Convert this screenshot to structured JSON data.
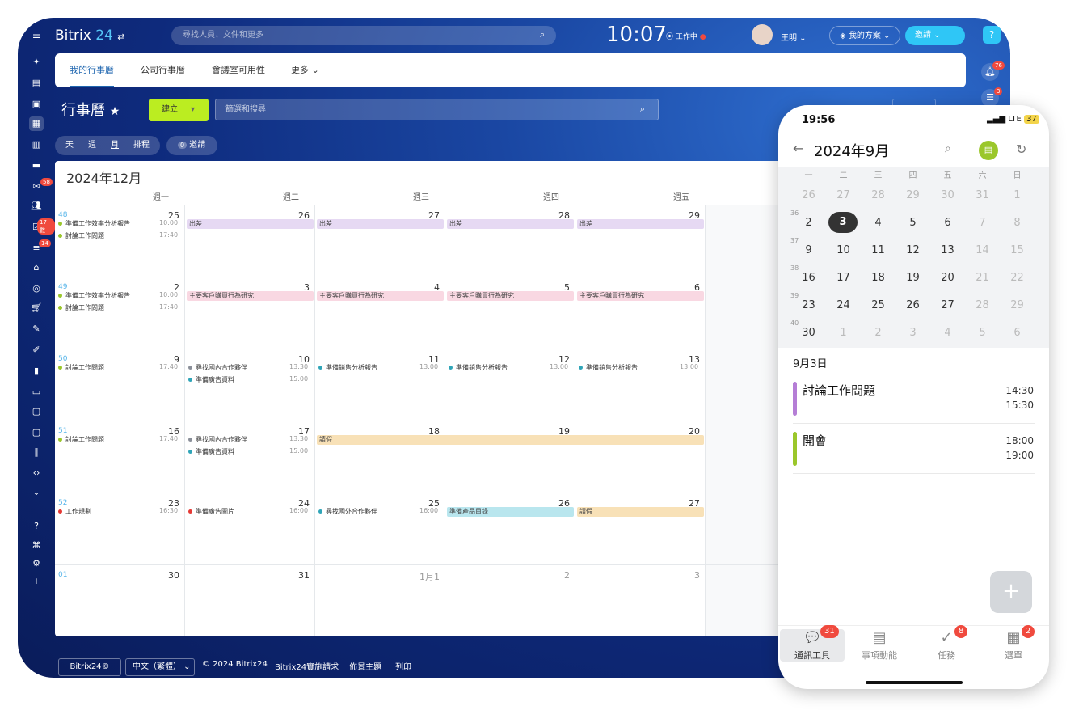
{
  "app": {
    "name": "Bitrix",
    "version": "24",
    "search_placeholder": "尋找人員、文件和更多",
    "time": "10:07",
    "work_status": "工作中",
    "user": "王明",
    "plan": "我的方案",
    "invite": "邀請"
  },
  "sidebar": {
    "badges": [
      "58",
      "17 數",
      "14"
    ],
    "top_badges": [
      "76",
      "3"
    ]
  },
  "tabs": [
    "我的行事曆",
    "公司行事曆",
    "會議室可用性",
    "更多"
  ],
  "page": {
    "title": "行事曆",
    "create": "建立",
    "filter_placeholder": "篩選和搜尋"
  },
  "views": {
    "day": "天",
    "week": "週",
    "month": "月",
    "schedule": "排程",
    "invites_count": "0",
    "invites": "邀請"
  },
  "calendar": {
    "month_label": "2024年12月",
    "weekdays": [
      "週一",
      "週二",
      "週三",
      "週四",
      "週五"
    ],
    "weeks": [
      {
        "wk": "48",
        "days": [
          "25",
          "26",
          "27",
          "28",
          "29"
        ],
        "sixth": ""
      },
      {
        "wk": "49",
        "days": [
          "2",
          "3",
          "4",
          "5",
          "6"
        ],
        "sixth": ""
      },
      {
        "wk": "50",
        "days": [
          "9",
          "10",
          "11",
          "12",
          "13"
        ],
        "sixth": ""
      },
      {
        "wk": "51",
        "days": [
          "16",
          "17",
          "18",
          "19",
          "20"
        ],
        "sixth": ""
      },
      {
        "wk": "52",
        "days": [
          "23",
          "24",
          "25",
          "26",
          "27"
        ],
        "sixth": ""
      },
      {
        "wk": "01",
        "days": [
          "30",
          "31",
          "1月1",
          "2",
          "3"
        ],
        "sixth": ""
      }
    ],
    "events": [
      {
        "week": 0,
        "day": 0,
        "row": 0,
        "title": "準備工作效率分析報告",
        "time": "10:00",
        "color": "#9bc72b"
      },
      {
        "week": 0,
        "day": 0,
        "row": 1,
        "title": "討論工作問題",
        "time": "17:40",
        "color": "#9bc72b"
      },
      {
        "week": 1,
        "day": 0,
        "row": 0,
        "title": "準備工作效率分析報告",
        "time": "10:00",
        "color": "#9bc72b"
      },
      {
        "week": 1,
        "day": 0,
        "row": 1,
        "title": "討論工作問題",
        "time": "17:40",
        "color": "#9bc72b"
      },
      {
        "week": 2,
        "day": 0,
        "row": 0,
        "title": "討論工作問題",
        "time": "17:40",
        "color": "#9bc72b"
      },
      {
        "week": 2,
        "day": 1,
        "row": 0,
        "title": "尋找國內合作夥伴",
        "time": "13:30",
        "color": "#8a8f99"
      },
      {
        "week": 2,
        "day": 1,
        "row": 1,
        "title": "準備廣告資料",
        "time": "15:00",
        "color": "#2fa5b8"
      },
      {
        "week": 2,
        "day": 2,
        "row": 0,
        "title": "準備銷售分析報告",
        "time": "13:00",
        "color": "#2fa5b8"
      },
      {
        "week": 2,
        "day": 3,
        "row": 0,
        "title": "準備銷售分析報告",
        "time": "13:00",
        "color": "#2fa5b8"
      },
      {
        "week": 2,
        "day": 4,
        "row": 0,
        "title": "準備銷售分析報告",
        "time": "13:00",
        "color": "#2fa5b8"
      },
      {
        "week": 3,
        "day": 0,
        "row": 0,
        "title": "討論工作問題",
        "time": "17:40",
        "color": "#9bc72b"
      },
      {
        "week": 3,
        "day": 1,
        "row": 0,
        "title": "尋找國內合作夥伴",
        "time": "13:30",
        "color": "#8a8f99"
      },
      {
        "week": 3,
        "day": 1,
        "row": 1,
        "title": "準備廣告資料",
        "time": "15:00",
        "color": "#2fa5b8"
      },
      {
        "week": 4,
        "day": 0,
        "row": 0,
        "title": "工作規劃",
        "time": "16:30",
        "color": "#e53935"
      },
      {
        "week": 4,
        "day": 1,
        "row": 0,
        "title": "準備廣告圖片",
        "time": "16:00",
        "color": "#e53935"
      },
      {
        "week": 4,
        "day": 2,
        "row": 0,
        "title": "尋找國外合作夥伴",
        "time": "16:00",
        "color": "#2fa5b8"
      }
    ],
    "bars": [
      {
        "week": 0,
        "from": 1,
        "to": 1,
        "title": "出差",
        "color": "#e6d9f3"
      },
      {
        "week": 0,
        "from": 2,
        "to": 2,
        "title": "出差",
        "color": "#e6d9f3"
      },
      {
        "week": 0,
        "from": 3,
        "to": 3,
        "title": "出差",
        "color": "#e6d9f3"
      },
      {
        "week": 0,
        "from": 4,
        "to": 4,
        "title": "出差",
        "color": "#e6d9f3"
      },
      {
        "week": 1,
        "from": 1,
        "to": 1,
        "title": "主要客戶購買行為研究",
        "color": "#f9d8e2"
      },
      {
        "week": 1,
        "from": 2,
        "to": 2,
        "title": "主要客戶購買行為研究",
        "color": "#f9d8e2"
      },
      {
        "week": 1,
        "from": 3,
        "to": 3,
        "title": "主要客戶購買行為研究",
        "color": "#f9d8e2"
      },
      {
        "week": 1,
        "from": 4,
        "to": 4,
        "title": "主要客戶購買行為研究",
        "color": "#f9d8e2"
      },
      {
        "week": 3,
        "from": 2,
        "to": 4,
        "title": "請假",
        "color": "#f8e1b7"
      },
      {
        "week": 4,
        "from": 3,
        "to": 3,
        "title": "準備產品目錄",
        "color": "#b9e6ee"
      },
      {
        "week": 4,
        "from": 4,
        "to": 4,
        "title": "請假",
        "color": "#f8e1b7"
      }
    ]
  },
  "footer": [
    "Bitrix24©",
    "中文（繁體）",
    "© 2024 Bitrix24",
    "Bitrix24實施請求",
    "佈景主題",
    "列印"
  ],
  "phone": {
    "time": "19:56",
    "network": "LTE",
    "battery": "37",
    "month": "2024年9月",
    "weekdays": [
      "一",
      "二",
      "三",
      "四",
      "五",
      "六",
      "日"
    ],
    "weeks": [
      {
        "wk": "",
        "days": [
          "26",
          "27",
          "28",
          "29",
          "30",
          "31",
          "1"
        ]
      },
      {
        "wk": "36",
        "days": [
          "2",
          "3",
          "4",
          "5",
          "6",
          "7",
          "8"
        ]
      },
      {
        "wk": "37",
        "days": [
          "9",
          "10",
          "11",
          "12",
          "13",
          "14",
          "15"
        ]
      },
      {
        "wk": "38",
        "days": [
          "16",
          "17",
          "18",
          "19",
          "20",
          "21",
          "22"
        ]
      },
      {
        "wk": "39",
        "days": [
          "23",
          "24",
          "25",
          "26",
          "27",
          "28",
          "29"
        ]
      },
      {
        "wk": "40",
        "days": [
          "30",
          "1",
          "2",
          "3",
          "4",
          "5",
          "6"
        ]
      }
    ],
    "selected_label": "9月3日",
    "events": [
      {
        "title": "討論工作問題",
        "start": "14:30",
        "end": "15:30",
        "color": "#b57ed6"
      },
      {
        "title": "開會",
        "start": "18:00",
        "end": "19:00",
        "color": "#9bc72b"
      }
    ],
    "tabs": [
      {
        "label": "通訊工具",
        "badge": "31"
      },
      {
        "label": "事項動能",
        "badge": ""
      },
      {
        "label": "任務",
        "badge": "8"
      },
      {
        "label": "選單",
        "badge": "2"
      }
    ]
  }
}
